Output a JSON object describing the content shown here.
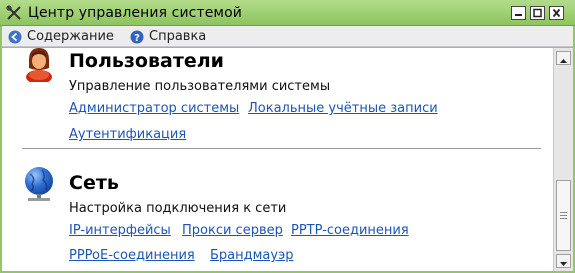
{
  "window": {
    "title": "Центр управления системой",
    "buttons": {
      "minimize": "minimize",
      "maximize": "maximize",
      "close": "close"
    }
  },
  "toolbar": {
    "contents_label": "Содержание",
    "help_label": "Справка"
  },
  "sections": {
    "users": {
      "title": "Пользователи",
      "description": "Управление пользователями системы",
      "links": {
        "sysadmin": "Администратор системы",
        "local_accounts": "Локальные учётные записи",
        "auth": "Аутентификация"
      }
    },
    "network": {
      "title": "Сеть",
      "description": "Настройка подключения к сети",
      "links": {
        "ip": "IP-интерфейсы",
        "proxy": "Прокси сервер",
        "pptp": "PPTP-соединения",
        "pppoe": "PPPoE-соединения",
        "firewall": "Брандмауэр"
      }
    }
  },
  "icons": {
    "app": "tools-icon",
    "contents": "back-arrow-icon",
    "help": "help-icon",
    "users": "user-icon",
    "network": "globe-network-icon"
  },
  "colors": {
    "titlebar": "#94c56a",
    "link": "#1c55b8"
  }
}
